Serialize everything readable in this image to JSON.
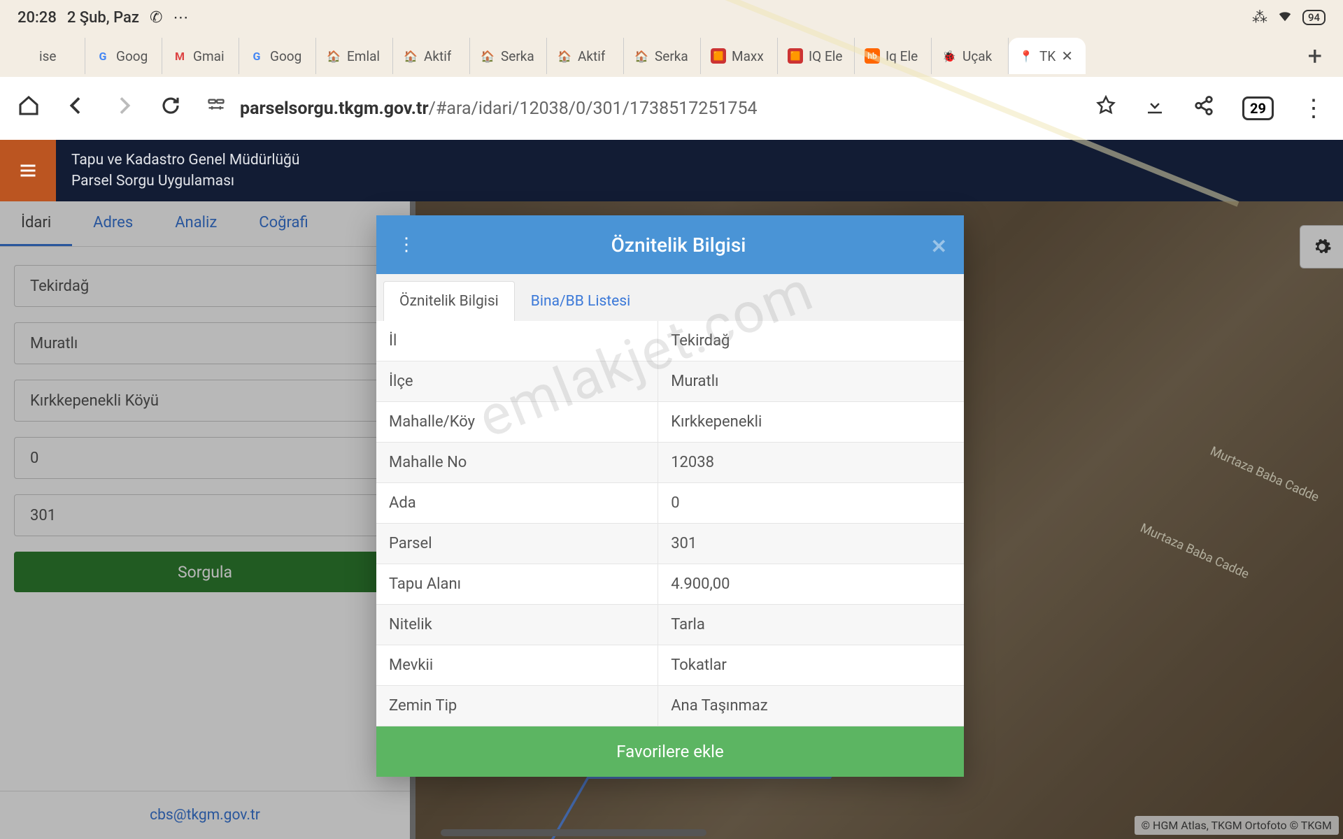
{
  "status": {
    "time": "20:28",
    "date": "2 Şub, Paz",
    "battery": "94"
  },
  "tabs": [
    {
      "favicon": " ",
      "label": "ise"
    },
    {
      "favicon": "G",
      "label": "Goog"
    },
    {
      "favicon": "M",
      "label": "Gmai"
    },
    {
      "favicon": "G",
      "label": "Goog"
    },
    {
      "favicon": "🏠",
      "label": "Emlal"
    },
    {
      "favicon": "🏠",
      "label": "Aktif"
    },
    {
      "favicon": "🏠",
      "label": "Serka"
    },
    {
      "favicon": "🏠",
      "label": "Aktif"
    },
    {
      "favicon": "🏠",
      "label": "Serka"
    },
    {
      "favicon": "🟧",
      "label": "Maxx"
    },
    {
      "favicon": "🟧",
      "label": "IQ Ele"
    },
    {
      "favicon": "hb",
      "label": "Iq Ele"
    },
    {
      "favicon": "🐞",
      "label": "Uçak"
    },
    {
      "favicon": "📍",
      "label": "TK",
      "active": true
    }
  ],
  "url": {
    "host": "parselsorgu.tkgm.gov.tr",
    "path": "/#ara/idari/12038/0/301/1738517251754"
  },
  "tab_count": "29",
  "app": {
    "line1": "Tapu ve Kadastro Genel Müdürlüğü",
    "line2": "Parsel Sorgu Uygulaması"
  },
  "form": {
    "tabs": [
      "İdari",
      "Adres",
      "Analiz",
      "Coğrafi"
    ],
    "fields": {
      "il": "Tekirdağ",
      "ilce": "Muratlı",
      "mahalle": "Kırkkepenekli Köyü",
      "ada": "0",
      "parsel": "301"
    },
    "submit": "Sorgula",
    "footer_email": "cbs@tkgm.gov.tr"
  },
  "map": {
    "road_label": "Murtaza Baba Cadde",
    "attribution": "© HGM Atlas, TKGM Ortofoto © TKGM"
  },
  "modal": {
    "title": "Öznitelik Bilgisi",
    "tabs": [
      "Öznitelik Bilgisi",
      "Bina/BB Listesi"
    ],
    "rows": [
      {
        "k": "İl",
        "v": "Tekirdağ"
      },
      {
        "k": "İlçe",
        "v": "Muratlı"
      },
      {
        "k": "Mahalle/Köy",
        "v": "Kırkkepenekli"
      },
      {
        "k": "Mahalle No",
        "v": "12038"
      },
      {
        "k": "Ada",
        "v": "0"
      },
      {
        "k": "Parsel",
        "v": "301"
      },
      {
        "k": "Tapu Alanı",
        "v": "4.900,00"
      },
      {
        "k": "Nitelik",
        "v": "Tarla"
      },
      {
        "k": "Mevkii",
        "v": "Tokatlar"
      },
      {
        "k": "Zemin Tip",
        "v": "Ana Taşınmaz"
      }
    ],
    "footer": "Favorilere ekle"
  },
  "watermark": "emlakjet.com"
}
